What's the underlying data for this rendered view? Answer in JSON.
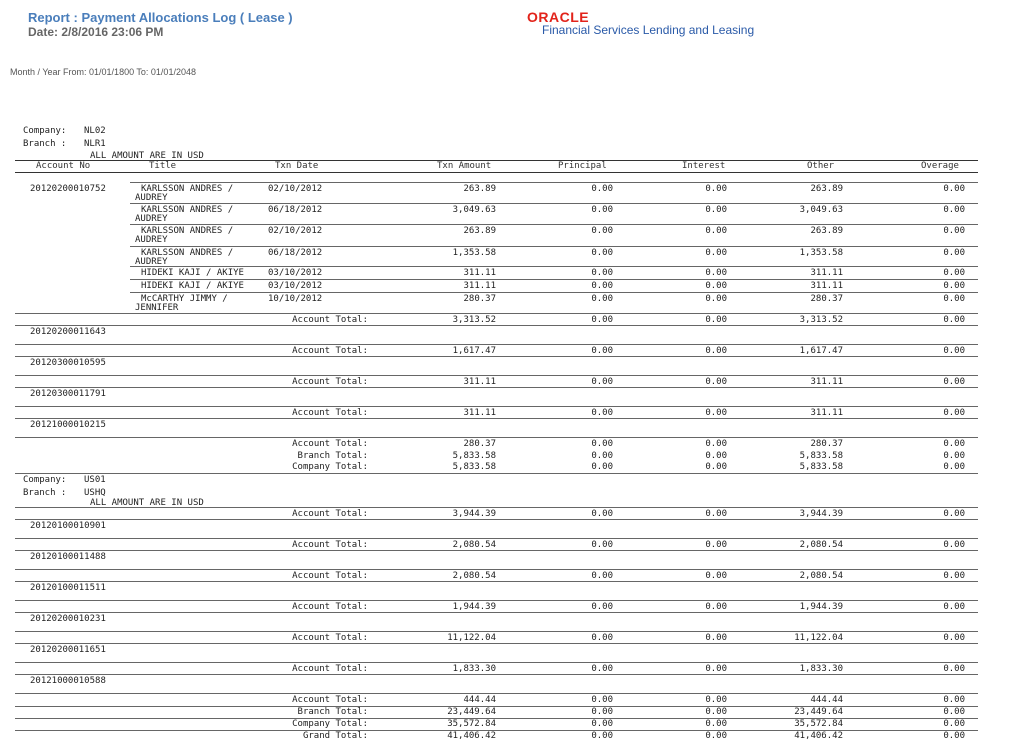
{
  "header": {
    "report_title": "Report : Payment Allocations Log ( Lease )",
    "date": "Date: 2/8/2016  23:06 PM",
    "logo_oracle": "ORACLE",
    "logo_sub": "Financial Services Lending and Leasing",
    "month_year": "Month / Year  From: 01/01/1800 To: 01/01/2048"
  },
  "columns": [
    "Account No",
    "Title",
    "Txn Date",
    "Txn Amount",
    "Principal",
    "Interest",
    "Other",
    "Overage"
  ],
  "companies": [
    {
      "company_label": "Company:",
      "company": "NL02",
      "branch_label": "Branch :",
      "branch": "NLR1",
      "currency_note": "ALL AMOUNT ARE IN USD",
      "accounts": [
        {
          "account": "20120200010752",
          "rows": [
            {
              "title1": "KARLSSON ANDRES /",
              "title2": "AUDREY",
              "date": "02/10/2012",
              "amount": "263.89",
              "principal": "0.00",
              "interest": "0.00",
              "other": "263.89",
              "overage": "0.00"
            },
            {
              "title1": "KARLSSON ANDRES /",
              "title2": "AUDREY",
              "date": "06/18/2012",
              "amount": "3,049.63",
              "principal": "0.00",
              "interest": "0.00",
              "other": "3,049.63",
              "overage": "0.00"
            },
            {
              "title1": "KARLSSON ANDRES /",
              "title2": "AUDREY",
              "date": "02/10/2012",
              "amount": "263.89",
              "principal": "0.00",
              "interest": "0.00",
              "other": "263.89",
              "overage": "0.00"
            },
            {
              "title1": "KARLSSON ANDRES /",
              "title2": "AUDREY",
              "date": "06/18/2012",
              "amount": "1,353.58",
              "principal": "0.00",
              "interest": "0.00",
              "other": "1,353.58",
              "overage": "0.00"
            },
            {
              "title1": "HIDEKI KAJI / AKIYE",
              "title2": "",
              "date": "03/10/2012",
              "amount": "311.11",
              "principal": "0.00",
              "interest": "0.00",
              "other": "311.11",
              "overage": "0.00"
            },
            {
              "title1": "HIDEKI KAJI / AKIYE",
              "title2": "",
              "date": "03/10/2012",
              "amount": "311.11",
              "principal": "0.00",
              "interest": "0.00",
              "other": "311.11",
              "overage": "0.00"
            },
            {
              "title1": "McCARTHY JIMMY /",
              "title2": "JENNIFER",
              "date": "10/10/2012",
              "amount": "280.37",
              "principal": "0.00",
              "interest": "0.00",
              "other": "280.37",
              "overage": "0.00"
            }
          ]
        }
      ],
      "account_total_label": "Account Total:",
      "totals_before": [
        {
          "amount": "3,313.52",
          "principal": "0.00",
          "interest": "0.00",
          "other": "3,313.52",
          "overage": "0.00"
        }
      ],
      "more_accounts": [
        {
          "account": "20120200011643",
          "total": {
            "amount": "1,617.47",
            "principal": "0.00",
            "interest": "0.00",
            "other": "1,617.47",
            "overage": "0.00"
          }
        },
        {
          "account": "20120300010595",
          "total": {
            "amount": "311.11",
            "principal": "0.00",
            "interest": "0.00",
            "other": "311.11",
            "overage": "0.00"
          }
        },
        {
          "account": "20120300011791",
          "total": {
            "amount": "311.11",
            "principal": "0.00",
            "interest": "0.00",
            "other": "311.11",
            "overage": "0.00"
          }
        },
        {
          "account": "20121000010215",
          "total": {
            "amount": "280.37",
            "principal": "0.00",
            "interest": "0.00",
            "other": "280.37",
            "overage": "0.00"
          }
        }
      ],
      "branch_total_label": "Branch Total:",
      "branch_total": {
        "amount": "5,833.58",
        "principal": "0.00",
        "interest": "0.00",
        "other": "5,833.58",
        "overage": "0.00"
      },
      "company_total_label": "Company Total:",
      "company_total": {
        "amount": "5,833.58",
        "principal": "0.00",
        "interest": "0.00",
        "other": "5,833.58",
        "overage": "0.00"
      }
    },
    {
      "company_label": "Company:",
      "company": "US01",
      "branch_label": "Branch :",
      "branch": "USHQ",
      "currency_note": "ALL AMOUNT ARE IN USD",
      "first_total": {
        "amount": "3,944.39",
        "principal": "0.00",
        "interest": "0.00",
        "other": "3,944.39",
        "overage": "0.00"
      },
      "more_accounts": [
        {
          "account": "20120100010901",
          "total": {
            "amount": "2,080.54",
            "principal": "0.00",
            "interest": "0.00",
            "other": "2,080.54",
            "overage": "0.00"
          }
        },
        {
          "account": "20120100011488",
          "total": {
            "amount": "2,080.54",
            "principal": "0.00",
            "interest": "0.00",
            "other": "2,080.54",
            "overage": "0.00"
          }
        },
        {
          "account": "20120100011511",
          "total": {
            "amount": "1,944.39",
            "principal": "0.00",
            "interest": "0.00",
            "other": "1,944.39",
            "overage": "0.00"
          }
        },
        {
          "account": "20120200010231",
          "total": {
            "amount": "11,122.04",
            "principal": "0.00",
            "interest": "0.00",
            "other": "11,122.04",
            "overage": "0.00"
          }
        },
        {
          "account": "20120200011651",
          "total": {
            "amount": "1,833.30",
            "principal": "0.00",
            "interest": "0.00",
            "other": "1,833.30",
            "overage": "0.00"
          }
        },
        {
          "account": "20121000010588",
          "total": {
            "amount": "444.44",
            "principal": "0.00",
            "interest": "0.00",
            "other": "444.44",
            "overage": "0.00"
          }
        }
      ],
      "branch_total": {
        "amount": "23,449.64",
        "principal": "0.00",
        "interest": "0.00",
        "other": "23,449.64",
        "overage": "0.00"
      },
      "company_total": {
        "amount": "35,572.84",
        "principal": "0.00",
        "interest": "0.00",
        "other": "35,572.84",
        "overage": "0.00"
      },
      "grand_total_label": "Grand Total:",
      "grand_total": {
        "amount": "41,406.42",
        "principal": "0.00",
        "interest": "0.00",
        "other": "41,406.42",
        "overage": "0.00"
      }
    }
  ]
}
